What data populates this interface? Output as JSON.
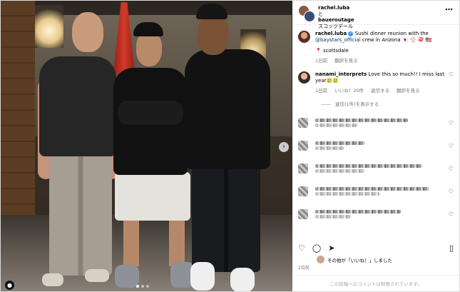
{
  "header": {
    "user_primary": "rachel.luba",
    "and_text": "と",
    "user_secondary": "baueroutage",
    "location": "スコッツデール",
    "more_icon": "more-horizontal-icon"
  },
  "caption": {
    "username": "rachel.luba",
    "text_pre": " Sushi dinner reunion with the ",
    "mention": "@baystars_official",
    "text_post": " crew in Arizona 🇯🇵 ⚾ 🍣 🇺🇸",
    "location_tag": "📍 scottsdale",
    "age": "1日前",
    "see_translation": "翻訳を見る"
  },
  "comment": {
    "username": "nanami_interprets",
    "text": " Love this so much!! I miss last year🥲🥲",
    "age": "1日前",
    "likes": "いいね！20件",
    "reply": "返信する",
    "see_translation": "翻訳を見る",
    "view_replies": "返信(1件)を表示する"
  },
  "actions": {
    "like_icon": "heart-icon",
    "comment_icon": "comment-icon",
    "share_icon": "paper-plane-icon",
    "save_icon": "bookmark-icon"
  },
  "likes_text": "その他が「いいね！」しました",
  "post_date": "2日前",
  "footer_text": "この投稿へのコメントは制限されています。"
}
